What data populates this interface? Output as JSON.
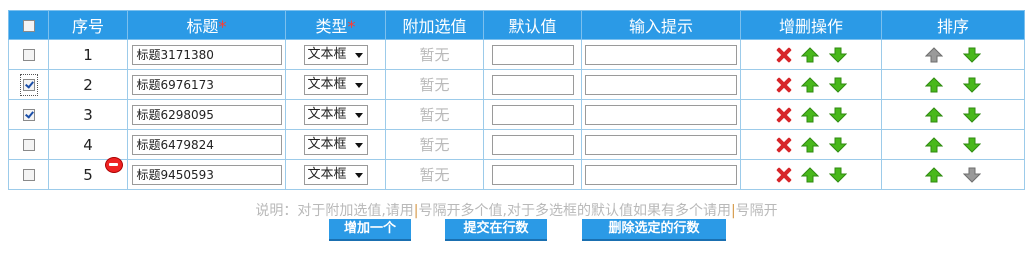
{
  "header": {
    "select_all": "",
    "seq": "序号",
    "title": "标题",
    "title_req": "*",
    "type": "类型",
    "type_req": "*",
    "extra": "附加选值",
    "default": "默认值",
    "hint": "输入提示",
    "ops": "增删操作",
    "sort": "排序"
  },
  "rows": [
    {
      "checked": false,
      "seq": "1",
      "title": "标题3171380",
      "type": "文本框",
      "extra": "暂无"
    },
    {
      "checked": true,
      "seq": "2",
      "title": "标题6976173",
      "type": "文本框",
      "extra": "暂无"
    },
    {
      "checked": true,
      "seq": "3",
      "title": "标题6298095",
      "type": "文本框",
      "extra": "暂无"
    },
    {
      "checked": false,
      "seq": "4",
      "title": "标题6479824",
      "type": "文本框",
      "extra": "暂无"
    },
    {
      "checked": false,
      "seq": "5",
      "title": "标题9450593",
      "type": "文本框",
      "extra": "暂无"
    }
  ],
  "note": {
    "part1": "说明：对于附加选值,请用",
    "bar": "|",
    "part2": "号隔开多个值,对于多选框的默认值如果有多个请用",
    "part3": "号隔开"
  },
  "buttons": {
    "add": "增加一个",
    "submit": "提交在行数",
    "delete": "删除选定的行数"
  },
  "colors": {
    "header_bg": "#2b9ae6",
    "delete_icon": "#d7262a",
    "arrow_green": "#49b81c",
    "arrow_disabled": "#9a9a9a"
  }
}
